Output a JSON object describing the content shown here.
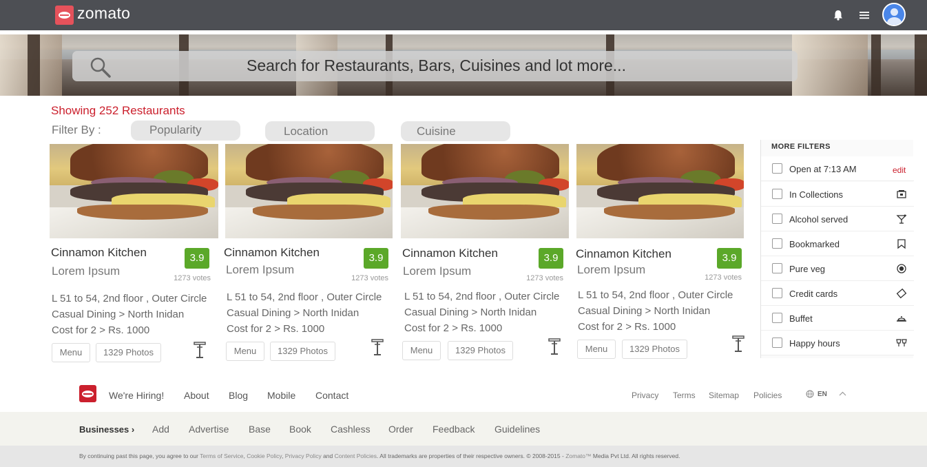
{
  "header": {
    "logo_text": "zomato",
    "icons": [
      "bell-icon",
      "menu-icon",
      "avatar"
    ]
  },
  "search": {
    "placeholder": "Search for Restaurants, Bars, Cuisines and lot more..."
  },
  "results": {
    "showing": "Showing 252 Restaurants",
    "filter_by_label": "Filter By :",
    "filters": [
      "Popularity",
      "Location",
      "Cuisine"
    ]
  },
  "cards": [
    {
      "name": "Cinnamon Kitchen",
      "subtitle": "Lorem Ipsum",
      "rating": "3.9",
      "votes": "1273 votes",
      "address": "L 51 to 54, 2nd floor , Outer Circle",
      "category": "Casual Dining > North Inidan",
      "cost": "Cost for 2 > Rs. 1000",
      "menu_label": "Menu",
      "photos_label": "1329 Photos"
    },
    {
      "name": "Cinnamon Kitchen",
      "subtitle": "Lorem Ipsum",
      "rating": "3.9",
      "votes": "1273 votes",
      "address": "L 51 to 54, 2nd floor , Outer Circle",
      "category": "Casual Dining > North Inidan",
      "cost": "Cost for 2 > Rs. 1000",
      "menu_label": "Menu",
      "photos_label": "1329 Photos"
    },
    {
      "name": "Cinnamon Kitchen",
      "subtitle": "Lorem Ipsum",
      "rating": "3.9",
      "votes": "1273 votes",
      "address": "L 51 to 54, 2nd floor , Outer Circle",
      "category": "Casual Dining > North Inidan",
      "cost": "Cost for 2 > Rs. 1000",
      "menu_label": "Menu",
      "photos_label": "1329 Photos"
    },
    {
      "name": "Cinnamon Kitchen",
      "subtitle": "Lorem Ipsum",
      "rating": "3.9",
      "votes": "1273 votes",
      "address": "L 51 to 54, 2nd floor , Outer Circle",
      "category": "Casual Dining > North Inidan",
      "cost": "Cost for 2 > Rs. 1000",
      "menu_label": "Menu",
      "photos_label": "1329 Photos"
    }
  ],
  "more_filters": {
    "title": "MORE FILTERS",
    "edit_label": "edit",
    "items": [
      {
        "label": "Open at 7:13 AM",
        "icon": "edit-link"
      },
      {
        "label": "In Collections",
        "icon": "collection-icon"
      },
      {
        "label": "Alcohol served",
        "icon": "cocktail-icon"
      },
      {
        "label": "Bookmarked",
        "icon": "bookmark-icon"
      },
      {
        "label": "Pure veg",
        "icon": "veg-icon"
      },
      {
        "label": "Credit cards",
        "icon": "card-icon"
      },
      {
        "label": "Buffet",
        "icon": "buffet-icon"
      },
      {
        "label": "Happy hours",
        "icon": "happy-hours-icon"
      }
    ]
  },
  "footer": {
    "links": [
      "We're Hiring!",
      "About",
      "Blog",
      "Mobile",
      "Contact"
    ],
    "right_links": [
      "Privacy",
      "Terms",
      "Sitemap",
      "Policies"
    ],
    "language": "EN",
    "businesses_label": "Businesses ›",
    "business_links": [
      "Add",
      "Advertise",
      "Base",
      "Book",
      "Cashless",
      "Order",
      "Feedback",
      "Guidelines"
    ],
    "legal_prefix": "By continuing past this page, you agree to our ",
    "legal_terms": "Terms of Service",
    "legal_sep1": ", ",
    "legal_cookie": "Cookie Policy",
    "legal_sep2": ", ",
    "legal_privacy": "Privacy Policy",
    "legal_and": " and ",
    "legal_content": "Content Policies",
    "legal_suffix": ". All trademarks are properties of their respective owners. © 2008-2015 - ",
    "legal_brand": "Zomato™",
    "legal_end": " Media Pvt Ltd. All rights reserved."
  },
  "colors": {
    "brand_red": "#cb202d",
    "topbar": "#4d4f54",
    "rating_green": "#5ba829"
  }
}
